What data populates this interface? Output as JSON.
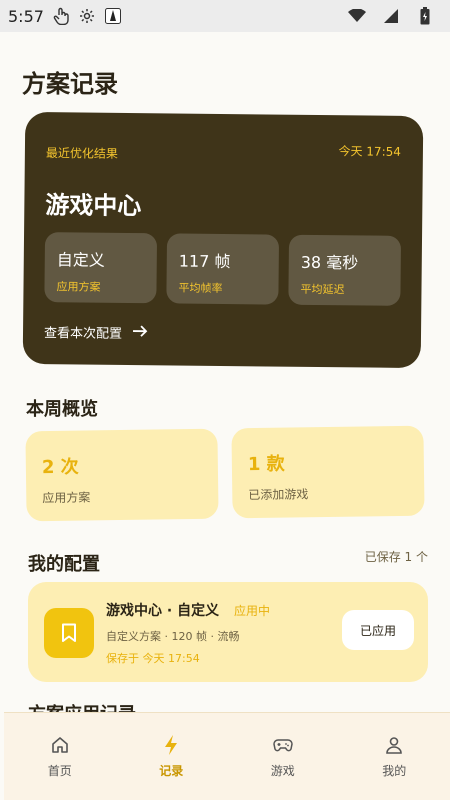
{
  "status_bar": {
    "time": "5:57"
  },
  "page": {
    "title": "方案记录"
  },
  "hero": {
    "label": "最近优化结果",
    "time": "今天 17:54",
    "name": "游戏中心",
    "stats": [
      {
        "value": "自定义",
        "label": "应用方案"
      },
      {
        "value": "117 帧",
        "label": "平均帧率"
      },
      {
        "value": "38 毫秒",
        "label": "平均延迟"
      }
    ],
    "link_label": "查看本次配置"
  },
  "week": {
    "title": "本周概览",
    "cards": [
      {
        "value": "2 次",
        "label": "应用方案"
      },
      {
        "value": "1 款",
        "label": "已添加游戏"
      }
    ]
  },
  "my_configs": {
    "title": "我的配置",
    "saved_count": "已保存 1 个",
    "items": [
      {
        "title": "游戏中心 · 自定义",
        "status": "应用中",
        "desc": "自定义方案 · 120 帧 · 流畅",
        "saved": "保存于 今天 17:54",
        "button": "已应用"
      }
    ]
  },
  "next_section_title": "方案应用记录",
  "nav": {
    "items": [
      {
        "label": "首页",
        "icon": "home-icon"
      },
      {
        "label": "记录",
        "icon": "lightning-icon",
        "active": true
      },
      {
        "label": "游戏",
        "icon": "gamepad-icon"
      },
      {
        "label": "我的",
        "icon": "person-icon"
      }
    ]
  },
  "colors": {
    "accent": "#f1c40f",
    "hero_bg": "#3f3419",
    "card_bg": "#fdeeb3"
  }
}
